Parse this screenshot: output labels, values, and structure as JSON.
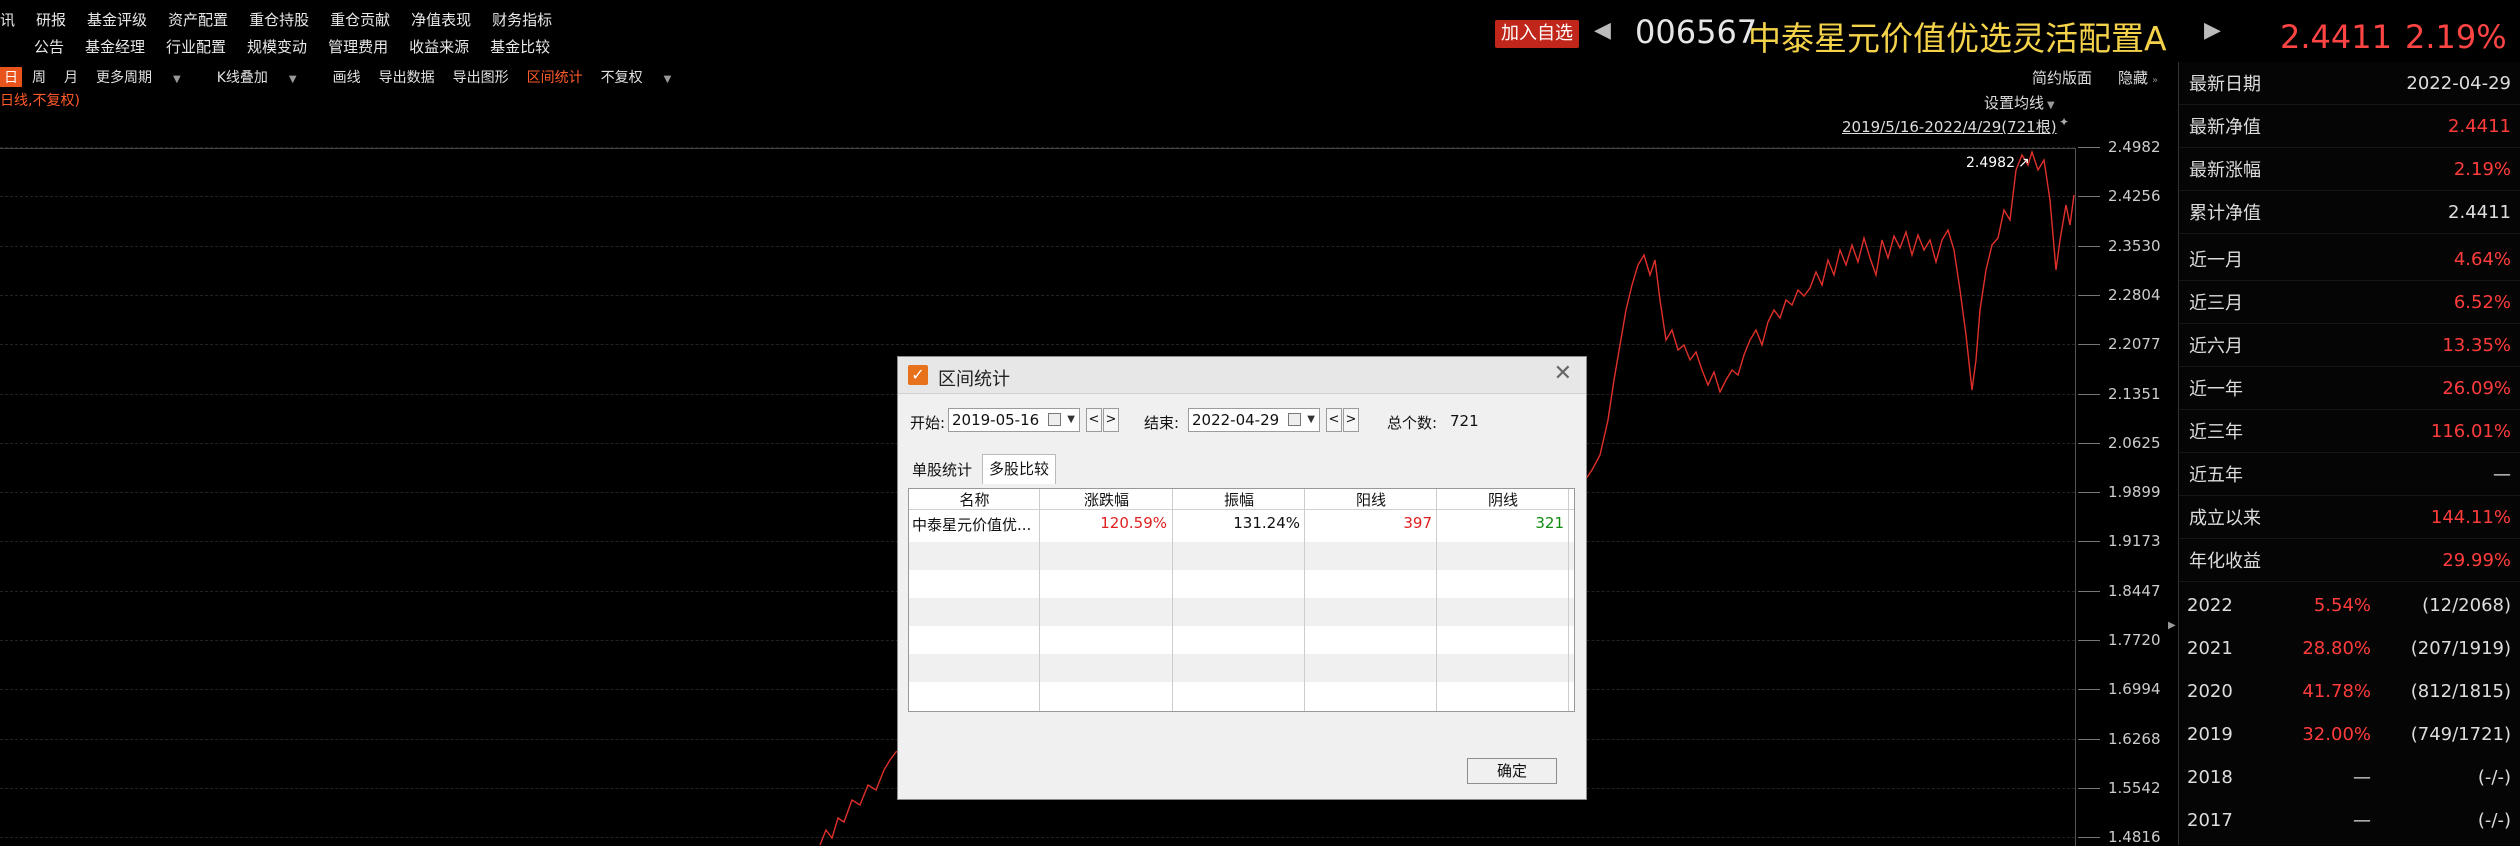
{
  "top_menu": {
    "row1": [
      "讯",
      "研报",
      "基金评级",
      "资产配置",
      "重仓持股",
      "重仓贡献",
      "净值表现",
      "财务指标"
    ],
    "row2": [
      "公告",
      "基金经理",
      "行业配置",
      "规模变动",
      "管理费用",
      "收益来源",
      "基金比较"
    ]
  },
  "toolbar": {
    "items": [
      "日",
      "周",
      "月",
      "更多周期",
      "K线叠加",
      "画线",
      "导出数据",
      "导出图形",
      "区间统计",
      "不复权"
    ],
    "note": "日线,不复权)",
    "right_items": [
      "简约版面",
      "隐藏"
    ]
  },
  "header": {
    "add_fav": "加入自选",
    "code": "006567",
    "name": "中泰星元价值优选灵活配置A",
    "nav": "2.4411",
    "change": "2.19%"
  },
  "chart": {
    "set_ma": "设置均线",
    "range_label": "2019/5/16-2022/4/29(721根)",
    "max_label": "2.4982",
    "yticks": [
      "2.4982",
      "2.4256",
      "2.3530",
      "2.2804",
      "2.2077",
      "2.1351",
      "2.0625",
      "1.9899",
      "1.9173",
      "1.8447",
      "1.7720",
      "1.6994",
      "1.6268",
      "1.5542",
      "1.4816"
    ],
    "line_color": "#e0302a"
  },
  "side_panel": {
    "stats": [
      {
        "label": "最新日期",
        "value": "2022-04-29",
        "color": "#dddddd"
      },
      {
        "label": "最新净值",
        "value": "2.4411",
        "color": "#ff3c3c"
      },
      {
        "label": "最新涨幅",
        "value": "2.19%",
        "color": "#ff3c3c"
      },
      {
        "label": "累计净值",
        "value": "2.4411",
        "color": "#dddddd"
      },
      {
        "label": "近一月",
        "value": "4.64%",
        "color": "#ff3c3c"
      },
      {
        "label": "近三月",
        "value": "6.52%",
        "color": "#ff3c3c"
      },
      {
        "label": "近六月",
        "value": "13.35%",
        "color": "#ff3c3c"
      },
      {
        "label": "近一年",
        "value": "26.09%",
        "color": "#ff3c3c"
      },
      {
        "label": "近三年",
        "value": "116.01%",
        "color": "#ff3c3c"
      },
      {
        "label": "近五年",
        "value": "—",
        "color": "#dddddd"
      },
      {
        "label": "成立以来",
        "value": "144.11%",
        "color": "#ff3c3c"
      },
      {
        "label": "年化收益",
        "value": "29.99%",
        "color": "#ff3c3c"
      }
    ],
    "years": [
      {
        "year": "2022",
        "ret": "5.54%",
        "rank": "(12/2068)",
        "color": "#ff3c3c"
      },
      {
        "year": "2021",
        "ret": "28.80%",
        "rank": "(207/1919)",
        "color": "#ff3c3c"
      },
      {
        "year": "2020",
        "ret": "41.78%",
        "rank": "(812/1815)",
        "color": "#ff3c3c"
      },
      {
        "year": "2019",
        "ret": "32.00%",
        "rank": "(749/1721)",
        "color": "#ff3c3c"
      },
      {
        "year": "2018",
        "ret": "—",
        "rank": "(-/-)",
        "color": "#dddddd"
      },
      {
        "year": "2017",
        "ret": "—",
        "rank": "(-/-)",
        "color": "#dddddd"
      }
    ]
  },
  "dialog": {
    "title": "区间统计",
    "start_label": "开始:",
    "start_date": "2019-05-16",
    "end_label": "结束:",
    "end_date": "2022-04-29",
    "count_label": "总个数:",
    "count": "721",
    "tabs": [
      "单股统计",
      "多股比较"
    ],
    "columns": [
      "名称",
      "涨跌幅",
      "振幅",
      "阳线",
      "阴线"
    ],
    "row": {
      "name": "中泰星元价值优...",
      "change": "120.59%",
      "amplitude": "131.24%",
      "up": "397",
      "down": "321"
    },
    "ok": "确定"
  }
}
